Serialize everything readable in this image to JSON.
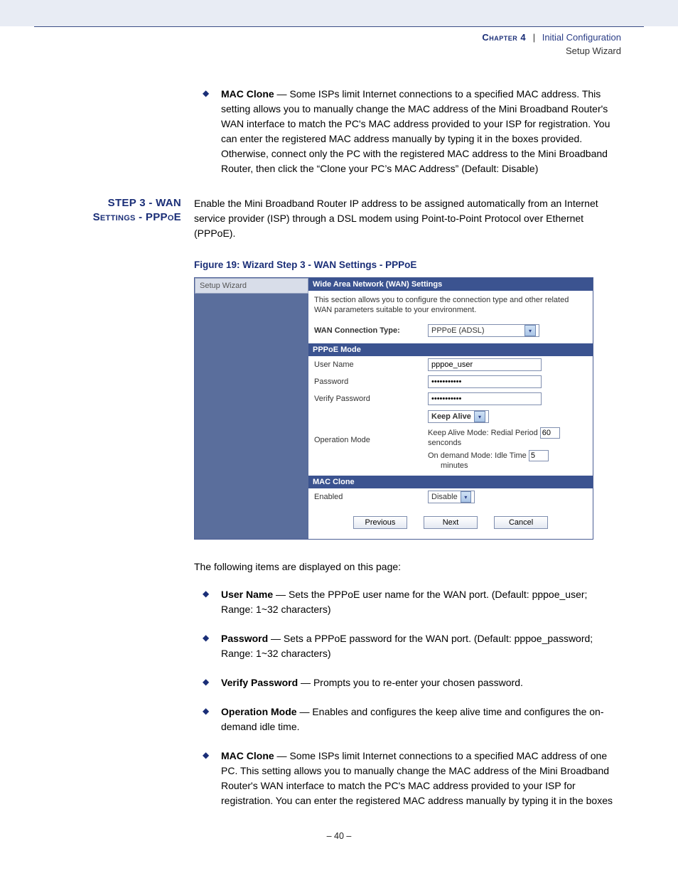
{
  "header": {
    "chapter": "Chapter 4",
    "sep": "|",
    "title": "Initial Configuration",
    "subtitle": "Setup Wizard"
  },
  "topBullets": [
    {
      "term": "MAC Clone",
      "sep": " — ",
      "text": "Some ISPs limit Internet connections to a specified MAC address. This setting allows you to manually change the MAC address of the Mini Broadband Router's WAN interface to match the PC's MAC address provided to your ISP for registration. You can enter the registered MAC address manually by typing it in the boxes provided. Otherwise, connect only the PC with the registered MAC address to the Mini Broadband Router, then click the “Clone your PC’s MAC Address” (Default: Disable)"
    }
  ],
  "step3": {
    "heading_line1": "Step 3 - WAN",
    "heading_line2": "Settings - PPPoE",
    "para": "Enable the Mini Broadband Router IP address to be assigned automatically from an Internet service provider (ISP) through a DSL modem using Point-to-Point Protocol over Ethernet (PPPoE)."
  },
  "figure": {
    "caption": "Figure 19:  Wizard Step 3 - WAN Settings - PPPoE"
  },
  "shot": {
    "sidebarLabel": "Setup Wizard",
    "bar_wan": "Wide Area Network (WAN) Settings",
    "desc": "This section allows you to configure the connection type and other related WAN parameters suitable to your environment.",
    "wanConnLabel": "WAN Connection Type:",
    "wanConnValue": "PPPoE (ADSL)",
    "bar_pppoe": "PPPoE Mode",
    "userNameLabel": "User Name",
    "userNameValue": "pppoe_user",
    "passwordLabel": "Password",
    "passwordValue": "•••••••••••",
    "verifyLabel": "Verify Password",
    "verifyValue": "•••••••••••",
    "opModeLabel": "Operation Mode",
    "opModeValue": "Keep Alive",
    "keepAliveText": "Keep Alive Mode: Redial Period ",
    "keepAliveVal": "60",
    "keepAliveUnit": "senconds",
    "onDemandText": "On demand Mode: Idle Time ",
    "onDemandVal": "5",
    "onDemandUnit": "minutes",
    "bar_mac": "MAC Clone",
    "enabledLabel": "Enabled",
    "enabledValue": "Disable",
    "btn_prev": "Previous",
    "btn_next": "Next",
    "btn_cancel": "Cancel"
  },
  "afterFig": "The following items are displayed on this page:",
  "bottomBullets": [
    {
      "term": "User Name",
      "sep": " — ",
      "text": "Sets the PPPoE user name for the WAN port. (Default: pppoe_user; Range: 1~32 characters)"
    },
    {
      "term": "Password",
      "sep": " — ",
      "text": "Sets a PPPoE password for the WAN port. (Default: pppoe_password; Range: 1~32 characters)"
    },
    {
      "term": "Verify Password",
      "sep": " — ",
      "text": "Prompts you to re-enter your chosen password."
    },
    {
      "term": "Operation Mode",
      "sep": " — ",
      "text": "Enables and configures the keep alive time and configures the on-demand idle time."
    },
    {
      "term": "MAC Clone",
      "sep": " — ",
      "text": "Some ISPs limit Internet connections to a specified MAC address of one PC. This setting allows you to manually change the MAC address of the Mini Broadband Router's WAN interface to match the PC's MAC address provided to your ISP for registration. You can enter the registered MAC address manually by typing it in the boxes"
    }
  ],
  "pageNumber": "–  40  –"
}
